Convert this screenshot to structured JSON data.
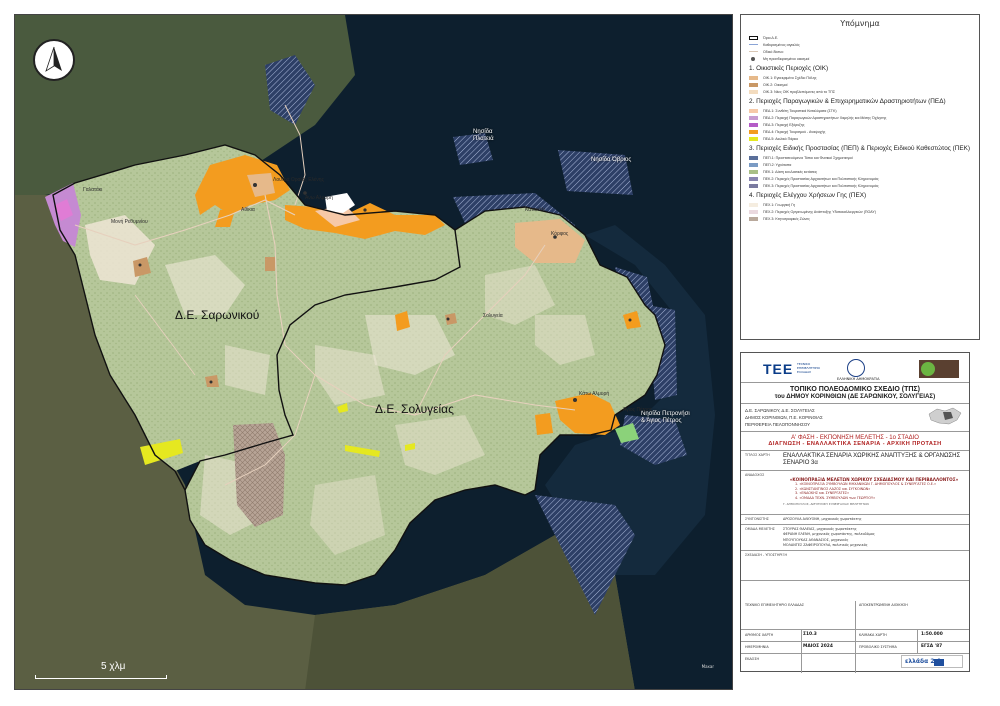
{
  "map": {
    "area_labels": {
      "saronikos": "Δ.Ε. Σαρωνικού",
      "solygeia": "Δ.Ε. Σολυγείας"
    },
    "island_labels": [
      {
        "name": "Νησίδα Πλατειά",
        "l1": "Νησίδα",
        "l2": "Πλατειά"
      },
      {
        "name": "Νησίδα Όβριος",
        "l1": "Νησίδα Όβριος",
        "l2": ""
      },
      {
        "name": "Νησίδα Πετρονήσι και Άγιος Πέτρος",
        "l1": "Νησίδα Πετρονήσι",
        "l2": "& Άγιος Πέτρος"
      }
    ],
    "place_labels": {
      "loutra": "Λουτρά Ωραίας Ελένης",
      "almyri": "Άνω Αλμυρή",
      "athikia": "Αθίκια",
      "galataki": "Γαλατάκι",
      "moni": "Μονή Ρεθυμνίου",
      "katakali": "Κατακάλι",
      "solygeia": "Σολυγεία",
      "kato_almyri": "Κάτω Αλμυρή",
      "agios_petros": "Άγιος Πέτρος",
      "korfos": "Κόρφος"
    },
    "scale_label": "5 χλμ",
    "credit": "Maxar"
  },
  "legend": {
    "title": "Υπόμνημα",
    "base_items": [
      {
        "label": "Όριο Δ.Ε.",
        "color": "#111111",
        "kind": "box"
      },
      {
        "label": "Καθορισμένος αιγιαλός",
        "color": "#8aa4d6",
        "kind": "line"
      },
      {
        "label": "Οδικό δίκτυο",
        "color": "#d9c7b5",
        "kind": "line"
      },
      {
        "label": "Μη προσδιορισμένοι οικισμοί",
        "color": "#555555",
        "kind": "dot"
      }
    ],
    "sections": [
      {
        "title": "1. Οικιστικές Περιοχές (ΟΙΚ)",
        "items": [
          {
            "label": "ΟΙΚ.1: Εγκεκριμένο Σχέδιο Πόλης",
            "color": "#e6b98a"
          },
          {
            "label": "ΟΙΚ.2: Οικισμοί",
            "color": "#c99866"
          },
          {
            "label": "ΟΙΚ.3: Νέες ΟΙΚ προβλεπόμενες από το ΤΠΣ",
            "color": "#f3dcbf"
          }
        ]
      },
      {
        "title": "2. Περιοχές Παραγωγικών & Επιχειρηματικών Δραστηριοτήτων (ΠΕΔ)",
        "items": [
          {
            "label": "ΠΕΔ.1: Συνθέτη Τουριστικά Καταλύματα (ΣΤΚ)",
            "color": "#f6c9a8"
          },
          {
            "label": "ΠΕΔ.2: Περιοχή Παραγωγικών Δραστηριοτήτων Χαμηλής και Μέσης Όχλησης",
            "color": "#c79bd0"
          },
          {
            "label": "ΠΕΔ.3: Περιοχή Εξόρυξης",
            "color": "#b45cc7"
          },
          {
            "label": "ΠΕΔ.4: Περιοχή Τουρισμού - Αναψυχής",
            "color": "#f39c1f"
          },
          {
            "label": "ΠΕΔ.5: Αιολικό Πάρκο",
            "color": "#e5e820"
          }
        ]
      },
      {
        "title": "3. Περιοχές Ειδικής Προστασίας (ΠΕΠ) & Περιοχές Ειδικού Καθεστώτος (ΠΕΚ)",
        "items": [
          {
            "label": "ΠΕΠ.1: Προστατευόμενοι Τόποι και Φυσικοί Σχηματισμοί",
            "color": "#5a6f9a"
          },
          {
            "label": "ΠΕΠ.2: Υγρότοπα",
            "color": "#7a9bc4"
          },
          {
            "label": "ΠΕΚ.1: Δάση και Δασικές εκτάσεις",
            "color": "#a9bf86"
          },
          {
            "label": "ΠΕΚ.2: Περιοχές Προστασίας Αρχαιοτήτων και Πολιτιστικής Κληρονομιάς",
            "color": "#8a86b0"
          },
          {
            "label": "ΠΕΚ.3: Περιοχές Προστασίας Αρχαιοτήτων και Πολιτιστικής Κληρονομιάς",
            "color": "#7a7aa0"
          }
        ]
      },
      {
        "title": "4. Περιοχές Ελέγχου Χρήσεων Γης (ΠΕΧ)",
        "items": [
          {
            "label": "ΠΕΧ.1: Γεωργική Γη",
            "color": "#f5ede0"
          },
          {
            "label": "ΠΕΧ.2: Περιοχές Οργανωμένης Ανάπτυξης Υδατοκαλλιεργειών (ΠΟΑΥ)",
            "color": "#ead9df"
          },
          {
            "label": "ΠΕΧ.3: Κτηνοτροφικές Ζώνες",
            "color": "#b9a99c"
          }
        ]
      }
    ]
  },
  "title_block": {
    "tee": "ΤΕΕ",
    "tee_sub1": "ΤΕΧΝΙΚΟ",
    "tee_sub2": "ΕΠΙΜΕΛΗΤΗΡΙΟ",
    "tee_sub3": "ΕΛΛΑΔΑΣ",
    "republic": "ΕΛΛΗΝΙΚΗ ΔΗΜΟΚΡΑΤΙΑ",
    "plan_title": "ΤΟΠΙΚΟ ΠΟΛΕΟΔΟΜΙΚΟ ΣΧΕΔΙΟ (ΤΠΣ)",
    "plan_subtitle": "του ΔΗΜΟΥ ΚΟΡΙΝΘΙΩΝ (ΔΕ ΣΑΡΩΝΙΚΟΥ, ΣΟΛΥΓΕΙΑΣ)",
    "region_lines": [
      "Δ.Ε. ΣΑΡΩΝΙΚΟΥ, Δ.Ε. ΣΟΛΥΓΕΙΑΣ",
      "ΔΗΜΟΣ ΚΟΡΙΝΘΙΩΝ, Π.Ε. ΚΟΡΙΝΘΙΑΣ",
      "ΠΕΡΙΦΕΡΕΙΑ ΠΕΛΟΠΟΝΝΗΣΟΥ"
    ],
    "phase": "Α' ΦΑΣΗ - ΕΚΠΟΝΗΣΗ ΜΕΛΕΤΗΣ - 1ο ΣΤΑΔΙΟ",
    "phase_sub": "ΔΙΑΓΝΩΣΗ - ΕΝΑΛΛΑΚΤΙΚΑ ΣΕΝΑΡΙΑ - ΑΡΧΙΚΗ ΠΡΟΤΑΣΗ",
    "map_title_key": "ΤΙΤΛΟΣ ΧΑΡΤΗ",
    "map_title": "ΕΝΑΛΛΑΚΤΙΚΑ ΣΕΝΑΡΙΑ ΧΩΡΙΚΗΣ ΑΝΑΠΤΥΞΗΣ & ΟΡΓΑΝΩΣΗΣ",
    "map_title_2": "ΣΕΝΑΡΙΟ 3α",
    "consultant_key": "ΑΝΑΔΟΧΟΣ",
    "consultant": "«ΚΟΙΝΟΠΡΑΞΙΑ ΜΕΛΕΤΩΝ ΧΩΡΙΚΟΥ ΣΧΕΔΙΑΣΜΟΥ ΚΑΙ ΠΕΡΙΒΑΛΛΟΝΤΟΣ»",
    "consultant_members": [
      "1. «ΚΟΙΝΟΠΡΑΞΙΑ ΣΥΜΒΟΥΛΩΝ ΜΗΧΑΝΙΚΩΝ Γ. ΔΗΜΟΠΟΥΛΟΣ & ΣΥΝΕΡΓΑΤΕΣ Ο.Ε.»",
      "2. «ΚΩΝΣΤΑΝΤΙΝΟΣ ΛΑΖΟΣ και ΣΥΓΚΟΙΝΩΝ»",
      "3. «ΕΝΔΟΚΗΣ και ΣΥΝΕΡΓΑΤΕΣ»",
      "4. «ΟΜΑΔΑ ΤΕΧΝ. ΣΥΜΒΟΥΛΩΝ των ΓΕΩΡΓΙΟΥ»"
    ],
    "consultant_address": "Γ. ΔΗΜΟΠΟΥΛΟΣ, ΔΙΕΥΘΥΝΣΗ ΣΥΝΕΡΓΑΣΙΑΣ ΜΕΛΕΤΗΤΩΝ",
    "coordinator_key": "ΣΥΝΤΟΝΙΣΤΗΣ",
    "coordinator": "ΔΡΟΣΟΥΛΑ ΑΛΚΥΟΝΗ, μηχανικός χωροτάκτης",
    "team_key": "ΟΜΑΔΑ ΜΕΛΕΤΗΣ",
    "team": [
      "ΣΤΟΥΡΑΣ ΘΑΛΕΙΑΣ, μηχανικός χωροτάκτης",
      "ΦΕΡΑΝΗ ΕΛΕΝΗ, μηχανικός χωροτάκτης, πολεοδόμος",
      "ΜΠΟΥΓΙΟΥΚΑΣ ΑΘΑΝΑΣΙΟΣ, μηχανικός",
      "ΜΟΛΑΝΤΕΣ ΖΑΦΕΙΡΟΠΟΥΛΑ, πολιτικός μηχανικός"
    ],
    "cartography_key": "ΣΧΕΔΙΑΣΗ - ΥΠΟΣΤΗΡΙΞΗ",
    "checked_key": "ΤΕΧΝΙΚΟ ΕΠΙΜΕΛΗΤΗΡΙΟ ΕΛΛΑΔΑΣ",
    "approved_key": "ΑΠΟΚΕΝΤΡΩΜΕΝΗ ΔΙΟΙΚΗΣΗ",
    "map_no_key": "ΑΡΙΘΜΟΣ ΧΑΡΤΗ",
    "map_no": "Σ10.3",
    "scale_key": "ΚΛΙΜΑΚΑ ΧΑΡΤΗ",
    "scale": "1:50.000",
    "date_key": "ΗΜΕΡΟΜΗΝΙΑ",
    "date": "ΜΑΙΟΣ 2024",
    "program_key": "ΠΡΟΒΟΛΙΚΟ ΣΥΣΤΗΜΑ",
    "program": "ΕΓΣΑ '87",
    "issue_key": "ΕΚΔΟΣΗ",
    "espa": "ΕΣΠΑ",
    "espa_text": "ελλάδα 2.0"
  }
}
